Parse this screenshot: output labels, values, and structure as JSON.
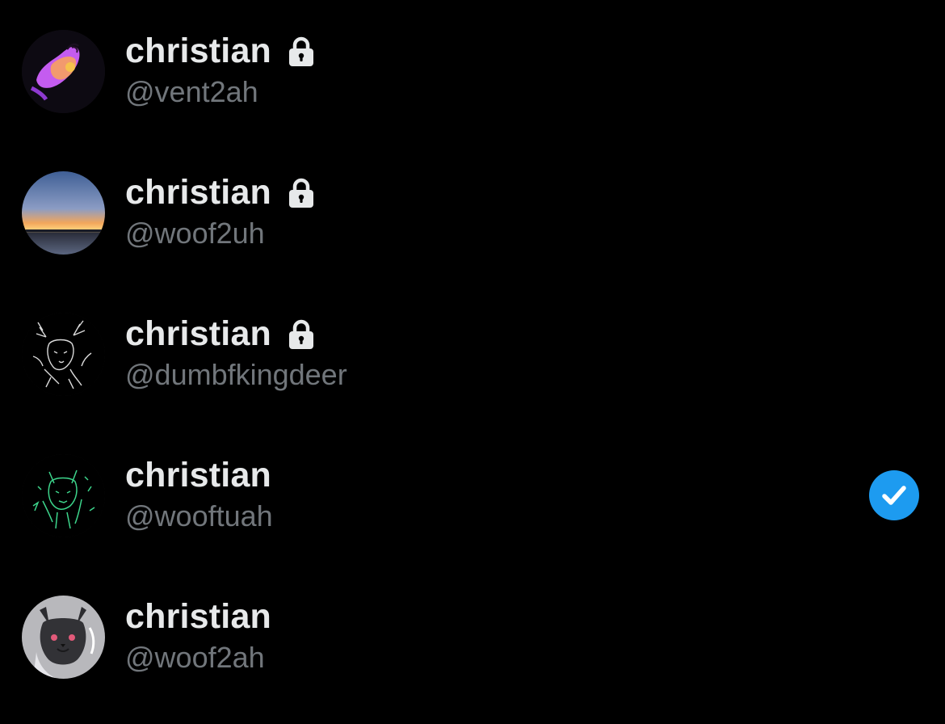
{
  "accounts": [
    {
      "display_name": "christian",
      "handle": "@vent2ah",
      "protected": true,
      "selected": false,
      "avatar": "purple-creature-avatar"
    },
    {
      "display_name": "christian",
      "handle": "@woof2uh",
      "protected": true,
      "selected": false,
      "avatar": "sunset-horizon-avatar"
    },
    {
      "display_name": "christian",
      "handle": "@dumbfkingdeer",
      "protected": true,
      "selected": false,
      "avatar": "white-deer-sketch-avatar"
    },
    {
      "display_name": "christian",
      "handle": "@wooftuah",
      "protected": false,
      "selected": true,
      "avatar": "green-wolf-sketch-avatar"
    },
    {
      "display_name": "christian",
      "handle": "@woof2ah",
      "protected": false,
      "selected": false,
      "avatar": "gray-wolf-drawing-avatar"
    }
  ],
  "colors": {
    "background": "#000000",
    "display_name": "#e7e9ea",
    "handle": "#71767b",
    "accent": "#1d9bf0"
  },
  "icons": {
    "lock": "lock-icon",
    "selected": "checkmark-icon"
  }
}
